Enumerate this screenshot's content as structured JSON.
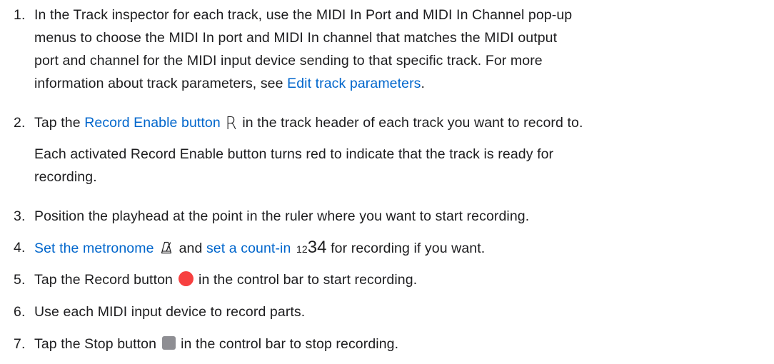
{
  "steps": [
    {
      "number": "1.",
      "p1_a": "In the Track inspector for each track, use the MIDI In Port and MIDI In Channel pop-up",
      "p1_b": "menus to choose the MIDI In port and MIDI In channel that matches the MIDI output",
      "p1_c": "port and channel for the MIDI input device sending to that specific track. For more",
      "p1_d": "information about track parameters, see ",
      "link": "Edit track parameters",
      "p1_e": "."
    },
    {
      "number": "2.",
      "pre": "Tap the ",
      "link": "Record Enable button",
      "icon_glyph": "R",
      "post": " in the track header of each track you want to record to.",
      "note_a": "Each activated Record Enable button turns red to indicate that the track is ready for",
      "note_b": "recording."
    },
    {
      "number": "3.",
      "text": "Position the playhead at the point in the ruler where you want to start recording."
    },
    {
      "number": "4.",
      "link1": "Set the metronome",
      "mid": " and ",
      "link2": "set a count-in",
      "count_small": "12",
      "count_big": "34",
      "post": " for recording if you want."
    },
    {
      "number": "5.",
      "pre": "Tap the Record button ",
      "post": " in the control bar to start recording."
    },
    {
      "number": "6.",
      "text": "Use each MIDI input device to record parts."
    },
    {
      "number": "7.",
      "pre": "Tap the Stop button ",
      "post": " in the control bar to stop recording."
    }
  ],
  "icons": {
    "record_enable": "record-enable-icon",
    "metronome": "metronome-icon",
    "count_in": "count-in-icon",
    "record": "record-icon",
    "stop": "stop-icon"
  },
  "colors": {
    "text": "#1d1d1f",
    "link": "#0066cc",
    "record": "#f74040",
    "stop": "#8e8e93"
  }
}
